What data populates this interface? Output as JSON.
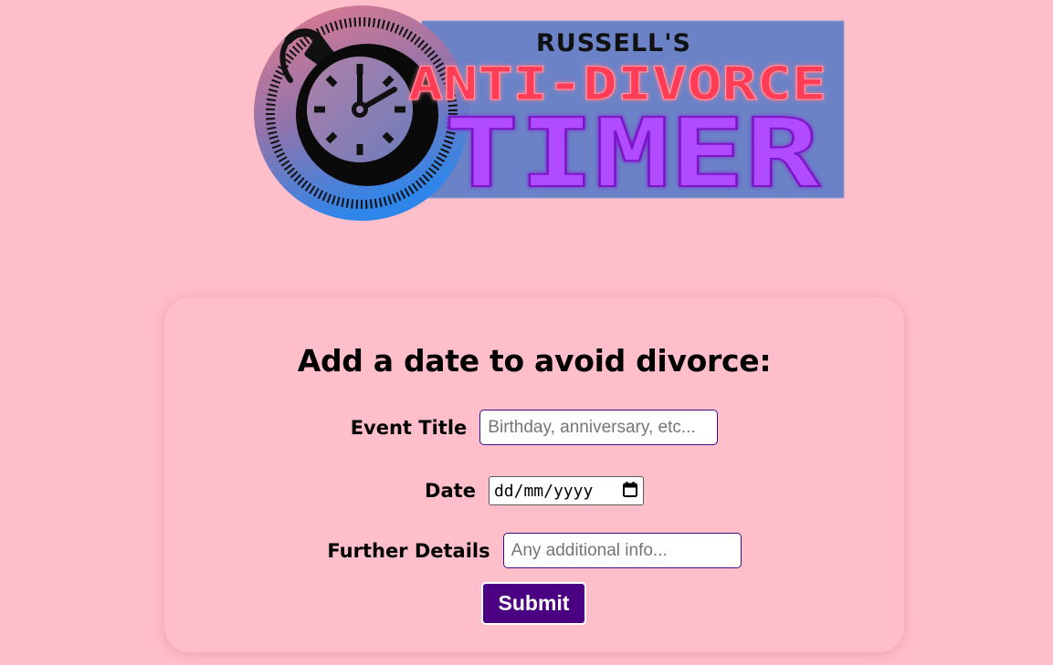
{
  "logo": {
    "line1": "RUSSELL'S",
    "line2": "ANTI-DIVORCE",
    "line3": "TIMER",
    "icon": "bomb-clock-icon",
    "colors": {
      "banner": "#6b82c7",
      "line1": "#111111",
      "line2": "#ff3d57",
      "line3": "#b04cff"
    }
  },
  "form": {
    "title": "Add a date to avoid divorce:",
    "event_title": {
      "label": "Event Title",
      "placeholder": "Birthday, anniversary, etc...",
      "value": ""
    },
    "date": {
      "label": "Date",
      "value": "dd/mm/yyyy",
      "icon": "calendar-icon"
    },
    "details": {
      "label": "Further Details",
      "placeholder": "Any additional info...",
      "value": ""
    },
    "submit_label": "Submit"
  },
  "colors": {
    "background": "#ffbfca",
    "accent": "#4a0283",
    "input_border": "#3d0a86"
  }
}
